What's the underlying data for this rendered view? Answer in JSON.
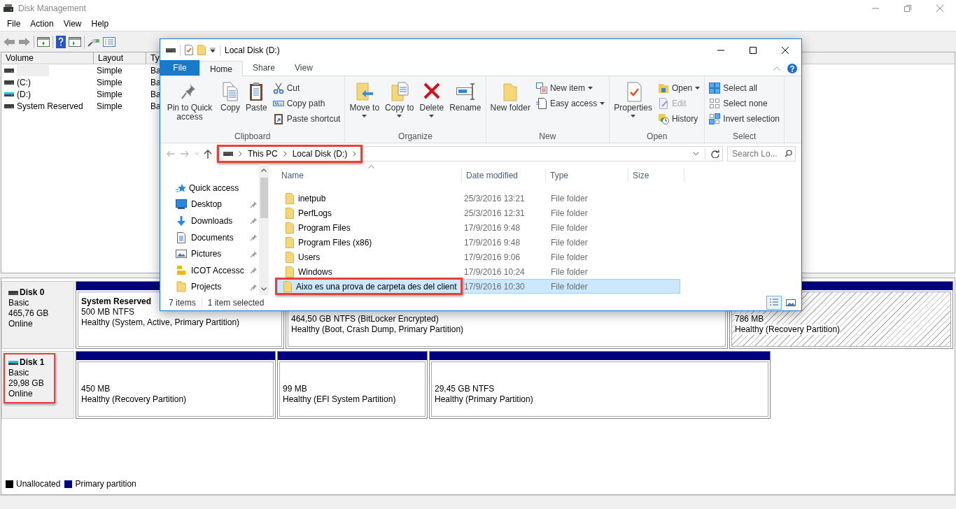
{
  "window": {
    "title": "Disk Management",
    "menu": [
      "File",
      "Action",
      "View",
      "Help"
    ]
  },
  "volume_table": {
    "columns": [
      "Volume",
      "Layout",
      "Ty"
    ],
    "rows": [
      {
        "volume": "",
        "redacted": true,
        "color": "#3c3c3c",
        "layout": "Simple",
        "column_3": "Ba"
      },
      {
        "volume": "(C:)",
        "redacted": false,
        "color": "#3c3c3c",
        "layout": "Simple",
        "column_3": "Ba"
      },
      {
        "volume": "(D:)",
        "redacted": false,
        "color": "#19c8e6",
        "layout": "Simple",
        "column_3": "Ba"
      },
      {
        "volume": "System Reserved",
        "redacted": false,
        "color": "#3c3c3c",
        "layout": "Simple",
        "column_3": "Ba"
      }
    ]
  },
  "disks": [
    {
      "name": "Disk 0",
      "type": "Basic",
      "size": "465,76 GB",
      "status": "Online",
      "color": "#3c3c3c",
      "highlighted": false,
      "partitions": [
        {
          "kind": "plain",
          "title": "System Reserved",
          "size": "500 MB NTFS",
          "health": "Healthy (System, Active, Primary Partition)"
        },
        {
          "kind": "plain",
          "size": "464,50 GB NTFS (BitLocker Encrypted)",
          "health": "Healthy (Boot, Crash Dump, Primary Partition)"
        },
        {
          "kind": "hatched",
          "size": "786 MB",
          "health": "Healthy (Recovery Partition)"
        }
      ]
    },
    {
      "name": "Disk 1",
      "type": "Basic",
      "size": "29,98 GB",
      "status": "Online",
      "color": "#19c8e6",
      "highlighted": true,
      "partitions": [
        {
          "kind": "plain",
          "size": "450 MB",
          "health": "Healthy (Recovery Partition)"
        },
        {
          "kind": "plain",
          "size": "99 MB",
          "health": "Healthy (EFI System Partition)"
        },
        {
          "kind": "plain",
          "size": "29,45 GB NTFS",
          "health": "Healthy (Primary Partition)"
        }
      ]
    }
  ],
  "legend": [
    {
      "label": "Unallocated",
      "color": "#000000"
    },
    {
      "label": "Primary partition",
      "color": "#000080"
    }
  ],
  "explorer": {
    "title": "Local Disk (D:)",
    "tabs": [
      {
        "label": "File",
        "kind": "menu",
        "selected": false
      },
      {
        "label": "Home",
        "kind": "tab",
        "selected": true
      },
      {
        "label": "Share",
        "kind": "tab",
        "selected": false
      },
      {
        "label": "View",
        "kind": "tab",
        "selected": false
      }
    ],
    "ribbon": [
      {
        "label": "Clipboard",
        "buttons": [
          {
            "label": "Pin to Quick access",
            "kind": "large",
            "dropdown": false,
            "disabled": false
          },
          {
            "label": "Copy",
            "kind": "large",
            "dropdown": false,
            "disabled": false
          },
          {
            "label": "Paste",
            "kind": "large",
            "dropdown": false,
            "disabled": false
          },
          {
            "label": "Cut",
            "kind": "small",
            "dropdown": false,
            "disabled": false
          },
          {
            "label": "Copy path",
            "kind": "small",
            "dropdown": false,
            "disabled": false
          },
          {
            "label": "Paste shortcut",
            "kind": "small",
            "dropdown": false,
            "disabled": false
          }
        ]
      },
      {
        "label": "Organize",
        "buttons": [
          {
            "label": "Move to",
            "kind": "large",
            "dropdown": true,
            "disabled": false
          },
          {
            "label": "Copy to",
            "kind": "large",
            "dropdown": true,
            "disabled": false
          },
          {
            "label": "Delete",
            "kind": "large",
            "dropdown": true,
            "disabled": false
          },
          {
            "label": "Rename",
            "kind": "large",
            "dropdown": false,
            "disabled": false
          }
        ]
      },
      {
        "label": "New",
        "buttons": [
          {
            "label": "New folder",
            "kind": "large",
            "dropdown": false,
            "disabled": false
          },
          {
            "label": "New item",
            "kind": "small",
            "dropdown": true,
            "disabled": false
          },
          {
            "label": "Easy access",
            "kind": "small",
            "dropdown": true,
            "disabled": false
          }
        ]
      },
      {
        "label": "Open",
        "buttons": [
          {
            "label": "Properties",
            "kind": "large",
            "dropdown": true,
            "disabled": false
          },
          {
            "label": "Open",
            "kind": "small",
            "dropdown": true,
            "disabled": false
          },
          {
            "label": "Edit",
            "kind": "small",
            "dropdown": false,
            "disabled": true
          },
          {
            "label": "History",
            "kind": "small",
            "dropdown": false,
            "disabled": false
          }
        ]
      },
      {
        "label": "Select",
        "buttons": [
          {
            "label": "Select all",
            "kind": "small",
            "dropdown": false,
            "disabled": false
          },
          {
            "label": "Select none",
            "kind": "small",
            "dropdown": false,
            "disabled": false
          },
          {
            "label": "Invert selection",
            "kind": "small",
            "dropdown": false,
            "disabled": false
          }
        ]
      }
    ],
    "address": {
      "breadcrumb": [
        "This PC",
        "Local Disk (D:)"
      ],
      "highlighted": true,
      "search_placeholder": "Search Lo..."
    },
    "nav": {
      "header": "Quick access",
      "items": [
        {
          "label": "Desktop",
          "pinned": true
        },
        {
          "label": "Downloads",
          "pinned": true
        },
        {
          "label": "Documents",
          "pinned": true
        },
        {
          "label": "Pictures",
          "pinned": true
        },
        {
          "label": "ICOT Accessc",
          "pinned": true
        },
        {
          "label": "Projects",
          "pinned": true
        }
      ]
    },
    "columns": [
      "Name",
      "Date modified",
      "Type",
      "Size"
    ],
    "files": [
      {
        "name": "inetpub",
        "date": "25/3/2016 13:21",
        "type": "File folder",
        "selected": false,
        "highlighted": false
      },
      {
        "name": "PerfLogs",
        "date": "25/3/2016 12:31",
        "type": "File folder",
        "selected": false,
        "highlighted": false
      },
      {
        "name": "Program Files",
        "date": "17/9/2016 9:48",
        "type": "File folder",
        "selected": false,
        "highlighted": false
      },
      {
        "name": "Program Files (x86)",
        "date": "17/9/2016 9:48",
        "type": "File folder",
        "selected": false,
        "highlighted": false
      },
      {
        "name": "Users",
        "date": "17/9/2016 9:06",
        "type": "File folder",
        "selected": false,
        "highlighted": false
      },
      {
        "name": "Windows",
        "date": "17/9/2016 10:24",
        "type": "File folder",
        "selected": false,
        "highlighted": false
      },
      {
        "name": "Aixo es una prova de carpeta des del client",
        "date": "17/9/2016 10:30",
        "type": "File folder",
        "selected": true,
        "highlighted": true
      }
    ],
    "status": [
      "7 items",
      "1 item selected"
    ],
    "views": [
      {
        "kind": "details",
        "selected": true
      },
      {
        "kind": "large_icons",
        "selected": false
      }
    ]
  }
}
